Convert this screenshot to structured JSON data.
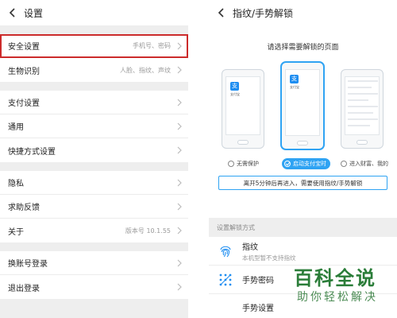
{
  "left": {
    "title": "设置",
    "groups": [
      [
        {
          "label": "安全设置",
          "value": "手机号、密码",
          "highlight": true
        },
        {
          "label": "生物识别",
          "value": "人脸、指纹、声纹"
        }
      ],
      [
        {
          "label": "支付设置",
          "value": ""
        },
        {
          "label": "通用",
          "value": ""
        },
        {
          "label": "快捷方式设置",
          "value": ""
        }
      ],
      [
        {
          "label": "隐私",
          "value": ""
        },
        {
          "label": "求助反馈",
          "value": ""
        },
        {
          "label": "关于",
          "value": "版本号 10.1.55"
        }
      ],
      [
        {
          "label": "换账号登录",
          "value": ""
        },
        {
          "label": "退出登录",
          "value": ""
        }
      ]
    ]
  },
  "right": {
    "title": "指纹/手势解锁",
    "prompt": "请选择需要解锁的页面",
    "app_label": "支付宝",
    "app_glyph": "支",
    "options": [
      "无需保护",
      "启动支付宝时",
      "进入财富、我的"
    ],
    "tip": "离开5分钟后再进入，需要使用指纹/手势解锁",
    "section_header": "设置解锁方式",
    "methods": {
      "fingerprint_title": "指纹",
      "fingerprint_sub": "本机型暂不支持指纹",
      "gesture_title": "手势密码",
      "gesture_settings": "手势设置"
    }
  },
  "watermark": {
    "line1": "百科全说",
    "line2": "助你轻松解决"
  },
  "colors": {
    "accent": "#2fa3f3",
    "highlight_border": "#cc2b2b",
    "watermark": "#2b7d39"
  },
  "icons": {
    "back": "chevron-left-icon",
    "row_arrow": "chevron-right-icon",
    "fingerprint": "fingerprint-icon",
    "gesture": "gesture-grid-icon"
  }
}
